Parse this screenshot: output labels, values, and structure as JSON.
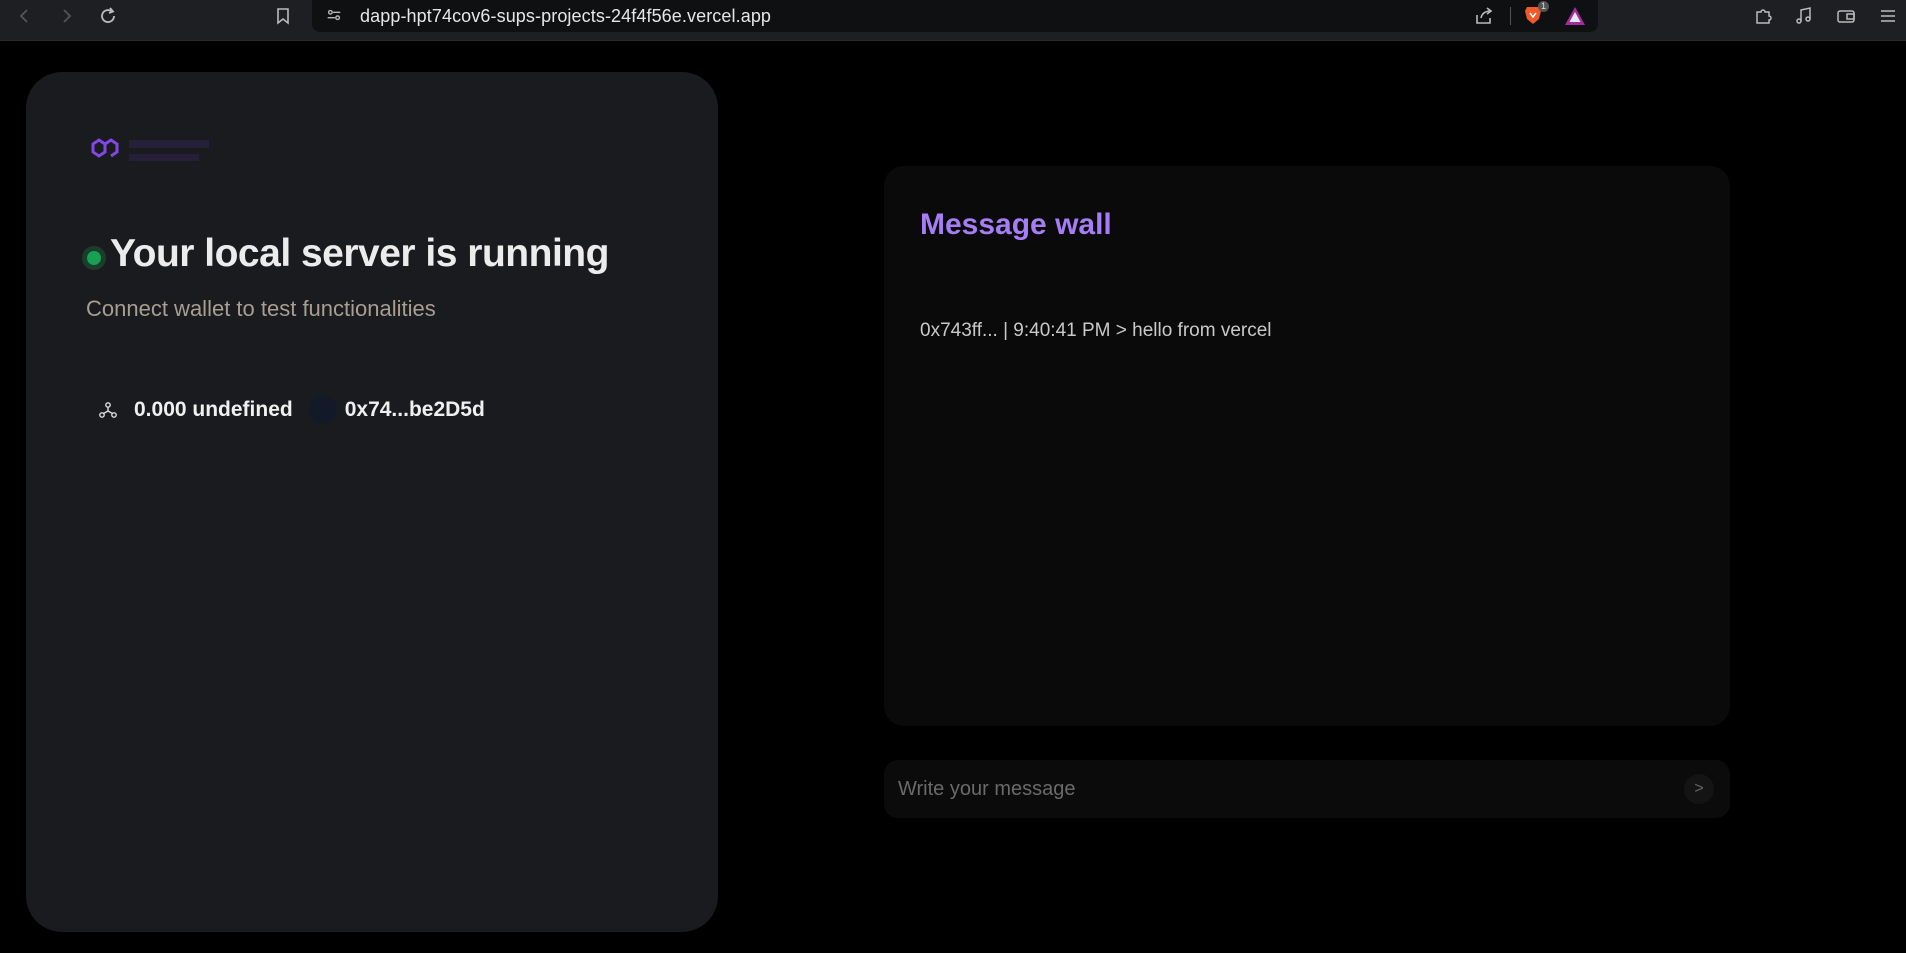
{
  "browser": {
    "url": "dapp-hpt74cov6-sups-projects-24f4f56e.vercel.app",
    "shields_count": "1",
    "icons": [
      "back-icon",
      "forward-icon",
      "reload-icon",
      "bookmark-icon",
      "site-settings-icon",
      "share-icon",
      "brave-shields-icon",
      "brave-rewards-icon",
      "extensions-icon",
      "media-icon",
      "wallet-icon",
      "menu-icon"
    ]
  },
  "left_card": {
    "heading": "Your local server is running",
    "subheading": "Connect wallet to test functionalities",
    "balance": "0.000 undefined",
    "address": "0x74...be2D5d",
    "status_color": "#18a053",
    "logo_color": "#8247e5"
  },
  "message_wall": {
    "title": "Message wall",
    "title_color": "#a67df5",
    "messages": [
      "0x743ff... | 9:40:41 PM > hello from vercel"
    ]
  },
  "composer": {
    "placeholder": "Write your message",
    "value": "",
    "send_label": ">"
  }
}
